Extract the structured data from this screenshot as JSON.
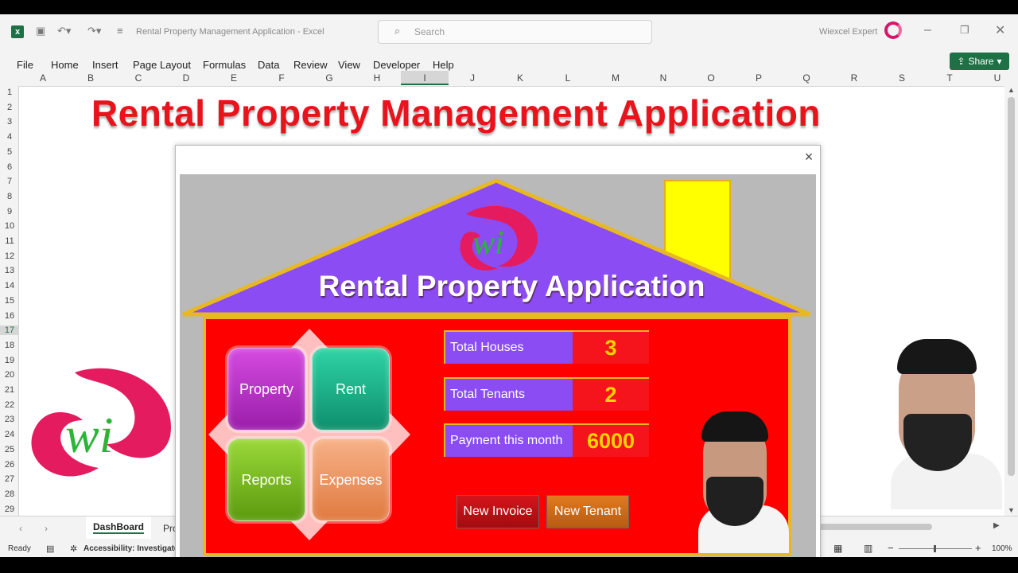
{
  "window": {
    "title": "Rental Property Management Application  -  Excel",
    "search_placeholder": "Search",
    "user": "Wiexcel Expert"
  },
  "ribbon": {
    "tabs": [
      "File",
      "Home",
      "Insert",
      "Page Layout",
      "Formulas",
      "Data",
      "Review",
      "View",
      "Developer",
      "Help"
    ],
    "share_label": "Share"
  },
  "sheet": {
    "columns": [
      "A",
      "B",
      "C",
      "D",
      "E",
      "F",
      "G",
      "H",
      "I",
      "J",
      "K",
      "L",
      "M",
      "N",
      "O",
      "P",
      "Q",
      "R",
      "S",
      "T",
      "U"
    ],
    "rows": [
      "1",
      "2",
      "3",
      "4",
      "5",
      "6",
      "7",
      "8",
      "9",
      "10",
      "11",
      "12",
      "13",
      "14",
      "15",
      "16",
      "17",
      "18",
      "19",
      "20",
      "21",
      "22",
      "23",
      "24",
      "25",
      "26",
      "27",
      "28",
      "29"
    ],
    "title": "Rental Property Management Application",
    "active_column": "I",
    "active_row": "17"
  },
  "sheet_tabs": [
    "DashBoard",
    "Pro"
  ],
  "status": {
    "ready": "Ready",
    "accessibility": "Accessibility: Investigate",
    "zoom": "100%"
  },
  "dialog": {
    "close": "×",
    "app_title": "Rental Property Application",
    "nav": {
      "property": "Property",
      "rent": "Rent",
      "reports": "Reports",
      "expenses": "Expenses"
    },
    "stats": [
      {
        "label": "Total Houses",
        "value": "3"
      },
      {
        "label": "Total Tenants",
        "value": "2"
      },
      {
        "label": "Payment this month",
        "value": "6000"
      }
    ],
    "actions": {
      "new_invoice": "New Invoice",
      "new_tenant": "New Tenant"
    }
  },
  "colors": {
    "excel_green": "#1e7145",
    "roof": "#8b4cf4",
    "house": "#ff0000",
    "accent_gold": "#e8b820",
    "property": "#b534c8",
    "rent": "#17b08a",
    "reports": "#84c21c",
    "expenses": "#f39a62"
  }
}
